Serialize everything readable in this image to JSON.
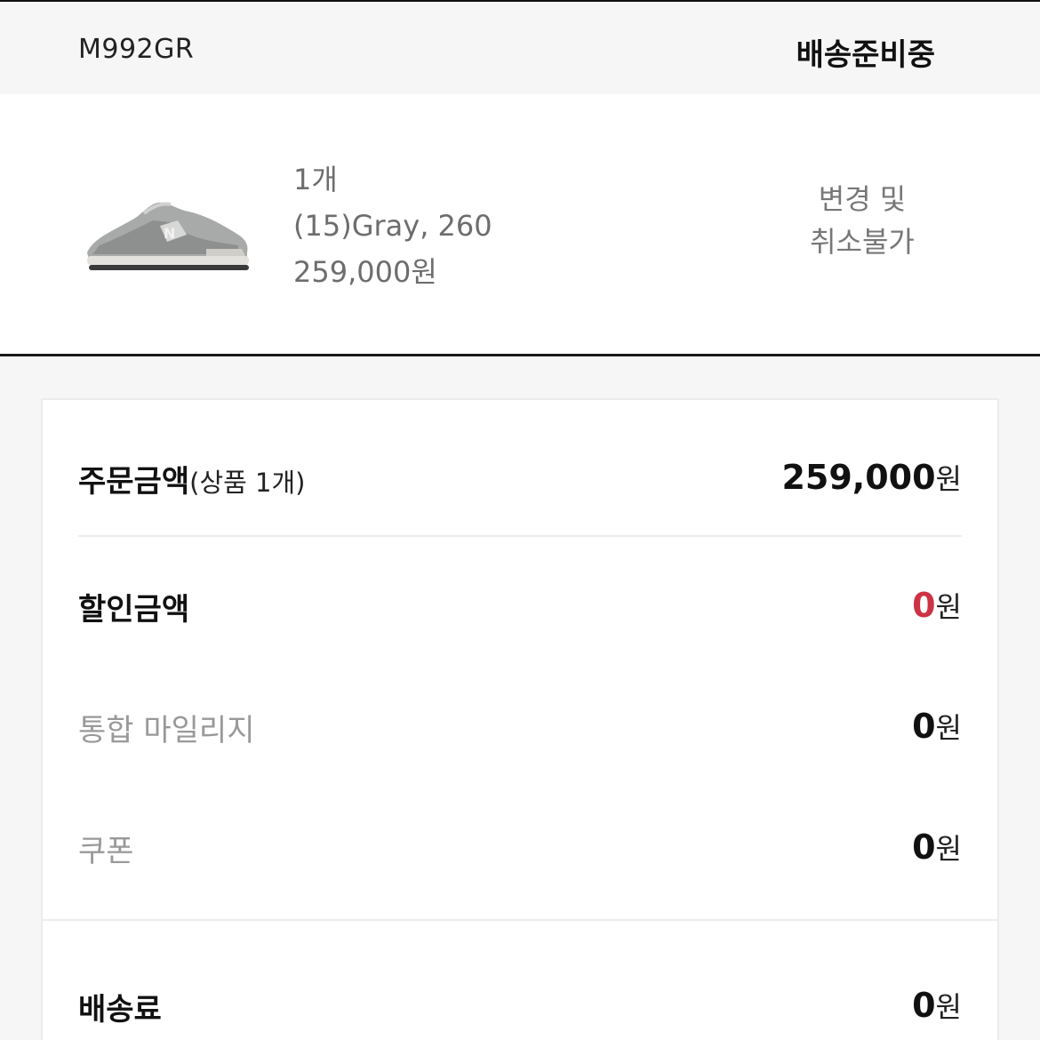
{
  "header": {
    "model_code": "M992GR",
    "status": "배송준비중"
  },
  "product": {
    "image_icon": "sneaker-image",
    "quantity": "1개",
    "option": "(15)Gray, 260",
    "price": "259,000원",
    "policy_line1": "변경 및",
    "policy_line2": "취소불가"
  },
  "summary": {
    "order_amount_label": "주문금액",
    "order_amount_sub": "(상품 1개)",
    "order_amount_value": "259,000",
    "currency": "원",
    "discount_label": "할인금액",
    "discount_value": "0",
    "mileage_label": "통합 마일리지",
    "mileage_value": "0",
    "coupon_label": "쿠폰",
    "coupon_value": "0",
    "shipping_label": "배송료",
    "shipping_value": "0"
  },
  "colors": {
    "discount_accent": "#cc3344",
    "rule": "#111111",
    "muted": "#999999"
  }
}
